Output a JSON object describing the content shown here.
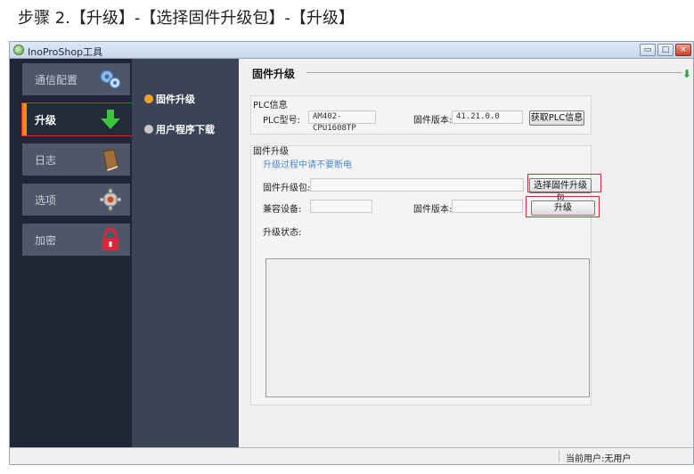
{
  "caption": "步骤 2.【升级】-【选择固件升级包】-【升级】",
  "window": {
    "title": "InoProShop工具",
    "buttons": {
      "minimize": "▭",
      "maximize": "□",
      "close": "×"
    }
  },
  "nav": {
    "items": [
      {
        "label": "通信配置",
        "icon": "network-gears-icon",
        "active": false
      },
      {
        "label": "升级",
        "icon": "download-arrow-icon",
        "active": true
      },
      {
        "label": "日志",
        "icon": "book-icon",
        "active": false
      },
      {
        "label": "选项",
        "icon": "gear-icon",
        "active": false
      },
      {
        "label": "加密",
        "icon": "lock-icon",
        "active": false
      }
    ]
  },
  "subnav": {
    "items": [
      {
        "label": "固件升级",
        "selected": true
      },
      {
        "label": "用户程序下载",
        "selected": false
      }
    ]
  },
  "content": {
    "section_title": "固件升级",
    "plc_info": {
      "group_title": "PLC信息",
      "model_label": "PLC型号:",
      "model_value": "AM402-CPU1608TP",
      "firmware_label": "固件版本:",
      "firmware_value": "41.21.0.0",
      "get_info_button": "获取PLC信息"
    },
    "upgrade": {
      "group_title": "固件升级",
      "hint": "升级过程中请不要断电",
      "package_label": "固件升级包:",
      "package_value": "",
      "select_button": "选择固件升级包",
      "compatible_label": "兼容设备:",
      "compatible_value": "",
      "firmware_label": "固件版本:",
      "firmware_value": "",
      "upgrade_button": "升级",
      "status_label": "升级状态:"
    }
  },
  "statusbar": {
    "current_user": "当前用户:无用户"
  },
  "colors": {
    "nav_bg": "#1f2636",
    "subnav_bg": "#3b4457",
    "accent_orange": "#f08a1c",
    "highlight_red": "#e0262a",
    "hint_blue": "#4d88c8"
  }
}
